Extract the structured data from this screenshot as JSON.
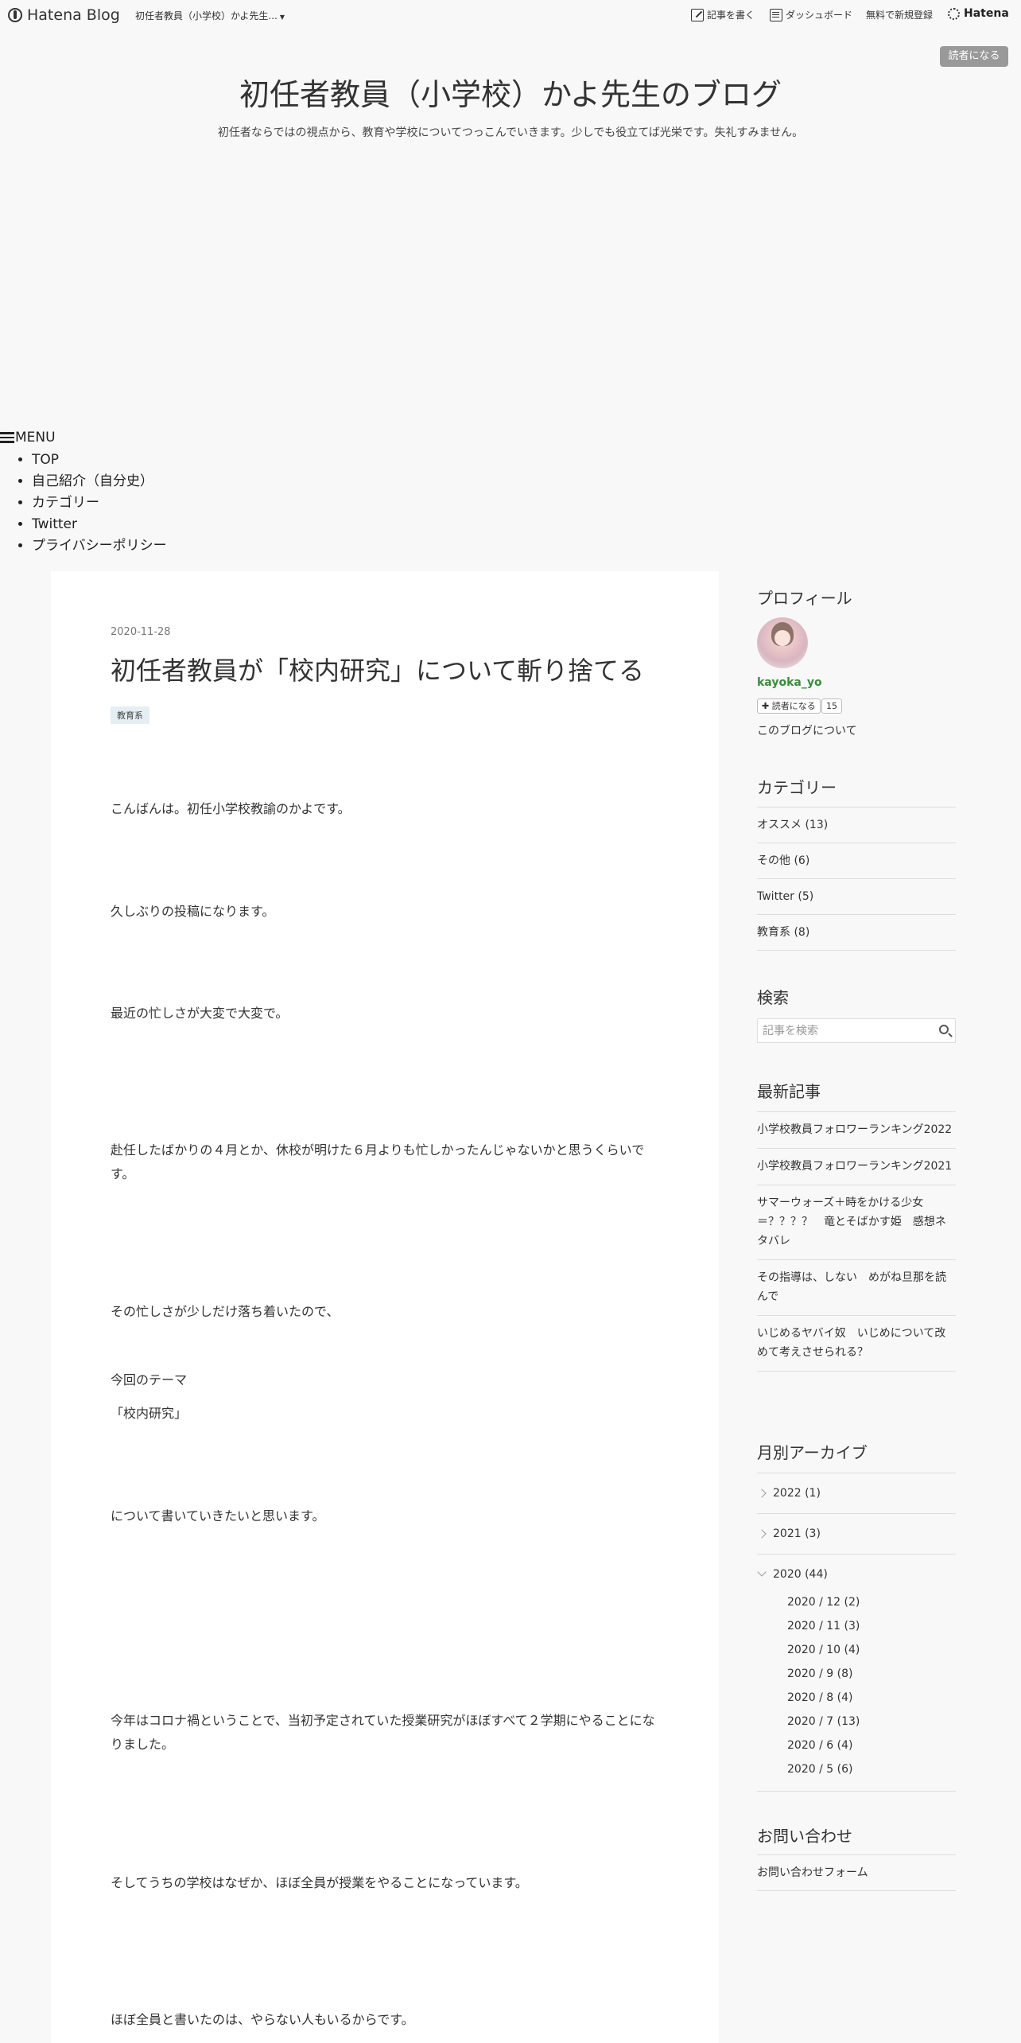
{
  "topbar": {
    "brand": "Hatena Blog",
    "blog_select": "初任者教員（小学校）かよ先生...",
    "write_label": "記事を書く",
    "dashboard_label": "ダッシュボード",
    "signup_label": "無料で新規登録",
    "hatena_label": "Hatena"
  },
  "header": {
    "subscribe_label": "読者になる",
    "title": "初任者教員（小学校）かよ先生のブログ",
    "description": "初任者ならではの視点から、教育や学校についてつっこんでいきます。少しでも役立てば光栄です。失礼すみません。"
  },
  "menu": {
    "toggle_label": "MENU",
    "items": [
      "TOP",
      "自己紹介（自分史）",
      "カテゴリー",
      "Twitter",
      "プライバシーポリシー"
    ]
  },
  "article": {
    "date": "2020-11-28",
    "title": "初任者教員が「校内研究」について斬り捨てる",
    "category": "教育系",
    "paragraphs": [
      "こんばんは。初任小学校教諭のかよです。",
      "久しぶりの投稿になります。",
      "最近の忙しさが大変で大変で。",
      "赴任したばかりの４月とか、休校が明けた６月よりも忙しかったんじゃないかと思うくらいです。",
      "その忙しさが少しだけ落ち着いたので、",
      "今回のテーマ",
      "「校内研究」",
      "について書いていきたいと思います。",
      "今年はコロナ禍ということで、当初予定されていた授業研究がほぼすべて２学期にやることになりました。",
      "そしてうちの学校はなぜか、ほぼ全員が授業をやることになっています。",
      "ほぼ全員と書いたのは、やらない人もいるからです。"
    ]
  },
  "sidebar": {
    "profile": {
      "heading": "プロフィール",
      "name": "kayoka_yo",
      "reader_label": "読者になる",
      "reader_count": "15",
      "about_link": "このブログについて"
    },
    "categories": {
      "heading": "カテゴリー",
      "items": [
        "オススメ (13)",
        "その他 (6)",
        "Twitter (5)",
        "教育系 (8)"
      ]
    },
    "search": {
      "heading": "検索",
      "placeholder": "記事を検索"
    },
    "recent": {
      "heading": "最新記事",
      "items": [
        "小学校教員フォロワーランキング2022",
        "小学校教員フォロワーランキング2021",
        "サマーウォーズ＋時をかける少女＝？？？？　竜とそばかす姫　感想ネタバレ",
        "その指導は、しない　めがね旦那を読んで",
        "いじめるヤバイ奴　いじめについて改めて考えさせられる？"
      ]
    },
    "archive": {
      "heading": "月別アーカイブ",
      "years": [
        "2022 (1)",
        "2021 (3)",
        "2020 (44)"
      ],
      "months_2020": [
        "2020 / 12 (2)",
        "2020 / 11 (3)",
        "2020 / 10 (4)",
        "2020 / 9 (8)",
        "2020 / 8 (4)",
        "2020 / 7 (13)",
        "2020 / 6 (4)",
        "2020 / 5 (6)"
      ]
    },
    "contact": {
      "heading": "お問い合わせ",
      "form_link": "お問い合わせフォーム"
    }
  }
}
